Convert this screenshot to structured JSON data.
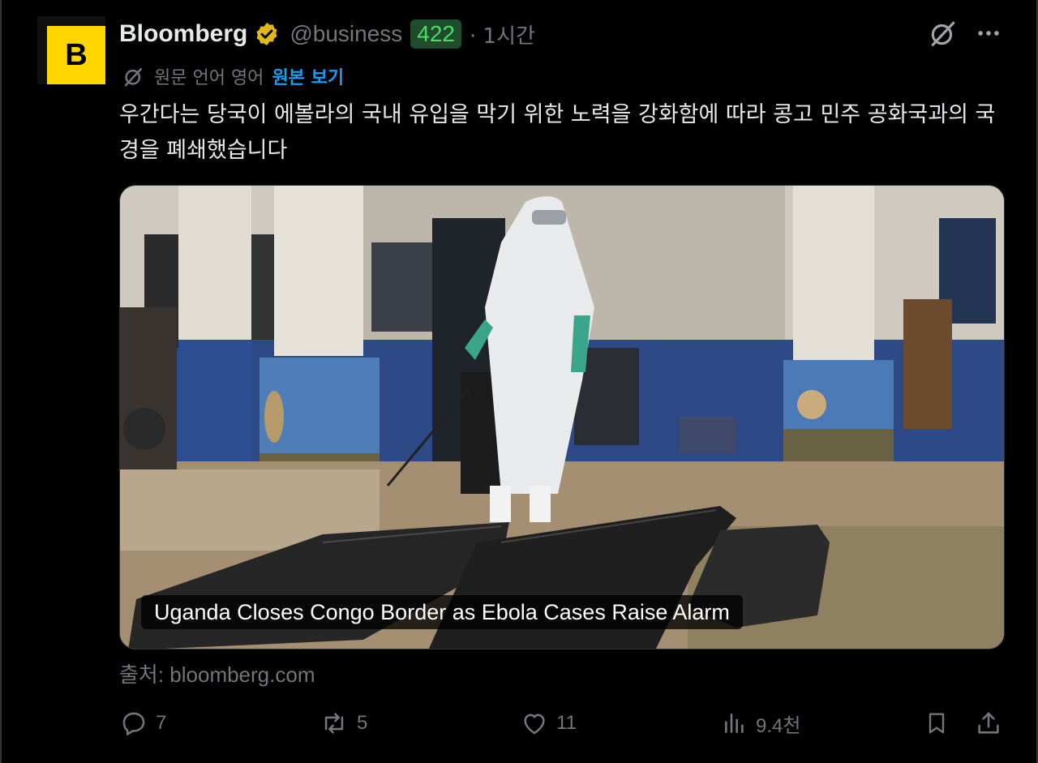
{
  "author": {
    "avatar_letter": "B",
    "name": "Bloomberg",
    "handle": "@business",
    "badge": "422",
    "time": "· 1시간"
  },
  "translation": {
    "label": "원문 언어 영어",
    "link": "원본 보기"
  },
  "tweet": {
    "text": "우간다는 당국이 에볼라의 국내 유입을 막기 위한 노력을 강화함에 따라 콩고 민주 공화국과의 국경을 폐쇄했습니다"
  },
  "card": {
    "caption": "Uganda Closes Congo Border as Ebola Cases Raise Alarm",
    "source": "출처: bloomberg.com"
  },
  "actions": {
    "replies": "7",
    "reposts": "5",
    "likes": "11",
    "views": "9.4천"
  },
  "colors": {
    "background": "#000000",
    "text": "#e7e9ea",
    "secondary": "#71767b",
    "link": "#1d9bf0",
    "verified": "#e2b719",
    "badge_bg": "#1f4d2b",
    "badge_text": "#4cd964",
    "avatar": "#ffd600"
  },
  "icons": [
    "verified-icon",
    "grok-icon",
    "more-icon",
    "translate-icon",
    "reply-icon",
    "repost-icon",
    "like-icon",
    "views-icon",
    "bookmark-icon",
    "share-icon"
  ]
}
